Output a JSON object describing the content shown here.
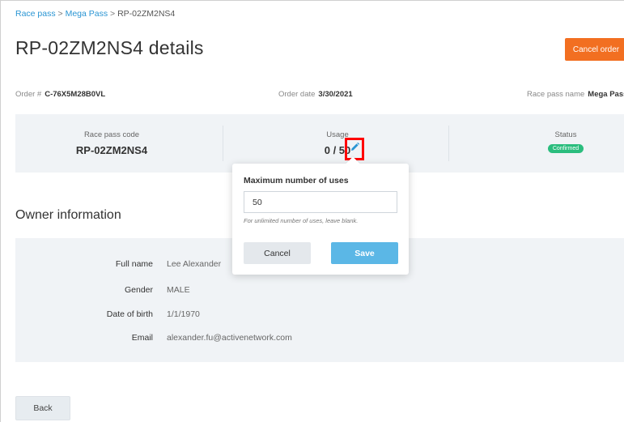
{
  "breadcrumb": {
    "item1": "Race pass",
    "sep1": " > ",
    "item2": "Mega Pass",
    "sep2": " > ",
    "current": "RP-02ZM2NS4"
  },
  "header": {
    "title": "RP-02ZM2NS4 details",
    "cancel_label": "Cancel order"
  },
  "meta": {
    "order_label": "Order #",
    "order_value": "C-76X5M28B0VL",
    "date_label": "Order date",
    "date_value": "3/30/2021",
    "pass_label": "Race pass name",
    "pass_value": "Mega Pass"
  },
  "summary": {
    "code_label": "Race pass code",
    "code_value": "RP-02ZM2NS4",
    "usage_label": "Usage",
    "usage_value": "0 / 50",
    "status_label": "Status",
    "status_value": "Confirmed"
  },
  "owner": {
    "title": "Owner information",
    "rows": [
      {
        "label": "Full name",
        "value": "Lee Alexander"
      },
      {
        "label": "Gender",
        "value": "MALE"
      },
      {
        "label": "Date of birth",
        "value": "1/1/1970"
      },
      {
        "label": "Email",
        "value": "alexander.fu@activenetwork.com"
      }
    ]
  },
  "popover": {
    "title": "Maximum number of uses",
    "value": "50",
    "hint": "For unlimited number of uses, leave blank.",
    "cancel_label": "Cancel",
    "save_label": "Save"
  },
  "footer": {
    "back_label": "Back"
  },
  "colors": {
    "accent_orange": "#f26f21",
    "link_blue": "#2a95d3",
    "save_blue": "#5bb7e6",
    "status_green": "#2bbd7e",
    "highlight_red": "#ff0000"
  }
}
